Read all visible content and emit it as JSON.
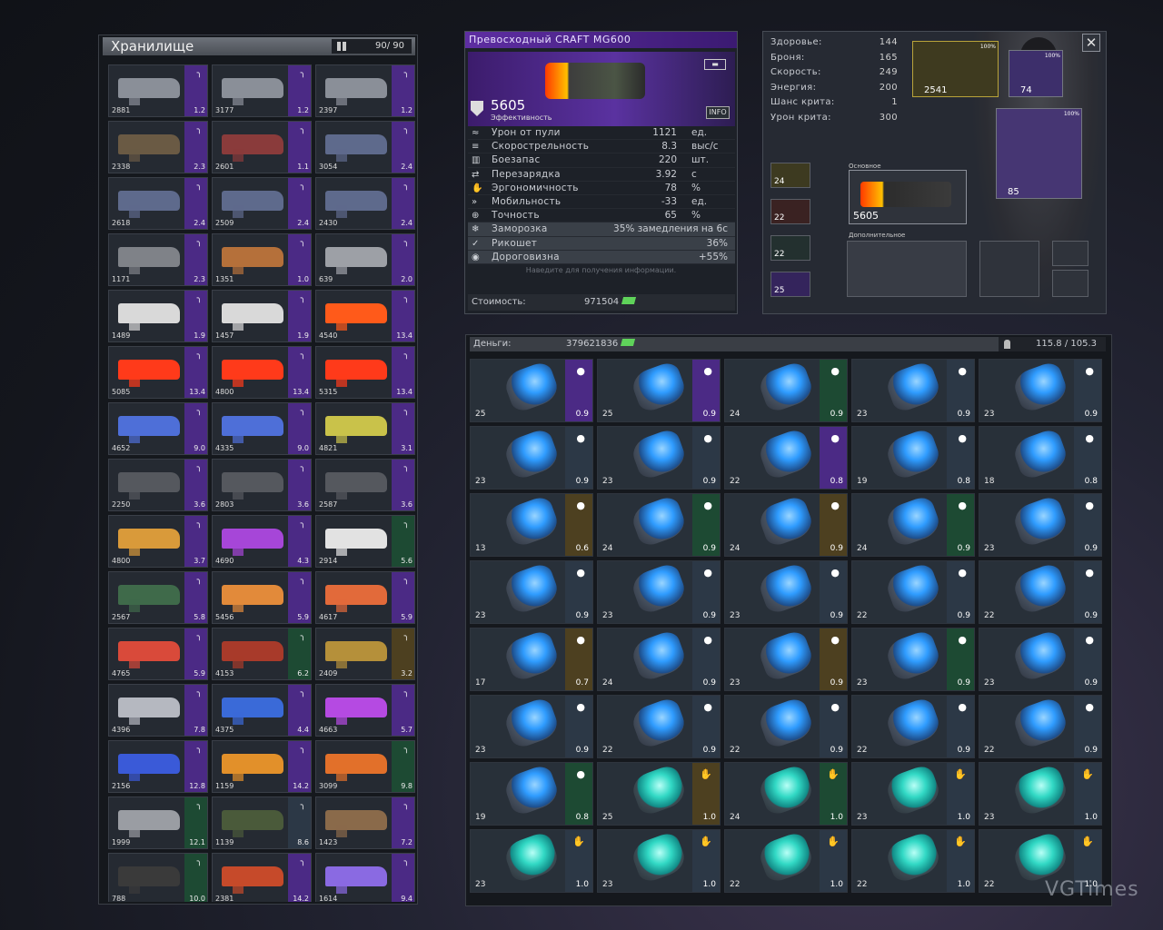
{
  "stash": {
    "title": "Хранилище",
    "capacity": "90/ 90",
    "items": [
      {
        "score": "2881",
        "weight": "1.2",
        "rarity": "violet",
        "color": "#8a8f98"
      },
      {
        "score": "3177",
        "weight": "1.2",
        "rarity": "violet",
        "color": "#8a8f98"
      },
      {
        "score": "2397",
        "weight": "1.2",
        "rarity": "violet",
        "color": "#8a8f98"
      },
      {
        "score": "2338",
        "weight": "2.3",
        "rarity": "violet",
        "color": "#6a5a44"
      },
      {
        "score": "2601",
        "weight": "1.1",
        "rarity": "violet",
        "color": "#8a3b3b"
      },
      {
        "score": "3054",
        "weight": "2.4",
        "rarity": "violet",
        "color": "#5e6a8c"
      },
      {
        "score": "2618",
        "weight": "2.4",
        "rarity": "violet",
        "color": "#5e6a8c"
      },
      {
        "score": "2509",
        "weight": "2.4",
        "rarity": "violet",
        "color": "#5e6a8c"
      },
      {
        "score": "2430",
        "weight": "2.4",
        "rarity": "violet",
        "color": "#5e6a8c"
      },
      {
        "score": "1171",
        "weight": "2.3",
        "rarity": "violet",
        "color": "#7f8288"
      },
      {
        "score": "1351",
        "weight": "1.0",
        "rarity": "violet",
        "color": "#b5703a"
      },
      {
        "score": "639",
        "weight": "2.0",
        "rarity": "violet",
        "color": "#9da0a6"
      },
      {
        "score": "1489",
        "weight": "1.9",
        "rarity": "violet",
        "color": "#d9d9d9"
      },
      {
        "score": "1457",
        "weight": "1.9",
        "rarity": "violet",
        "color": "#d9d9d9"
      },
      {
        "score": "4540",
        "weight": "13.4",
        "rarity": "violet",
        "color": "#ff5a1a"
      },
      {
        "score": "5085",
        "weight": "13.4",
        "rarity": "violet",
        "color": "#ff3a1a"
      },
      {
        "score": "4800",
        "weight": "13.4",
        "rarity": "violet",
        "color": "#ff3a1a"
      },
      {
        "score": "5315",
        "weight": "13.4",
        "rarity": "violet",
        "color": "#ff3a1a"
      },
      {
        "score": "4652",
        "weight": "9.0",
        "rarity": "violet",
        "color": "#4e6fd8"
      },
      {
        "score": "4335",
        "weight": "9.0",
        "rarity": "violet",
        "color": "#4e6fd8"
      },
      {
        "score": "4821",
        "weight": "3.1",
        "rarity": "violet",
        "color": "#c9c24a"
      },
      {
        "score": "2250",
        "weight": "3.6",
        "rarity": "violet",
        "color": "#55585e"
      },
      {
        "score": "2803",
        "weight": "3.6",
        "rarity": "violet",
        "color": "#55585e"
      },
      {
        "score": "2587",
        "weight": "3.6",
        "rarity": "violet",
        "color": "#55585e"
      },
      {
        "score": "4800",
        "weight": "3.7",
        "rarity": "violet",
        "color": "#d99a3a"
      },
      {
        "score": "4690",
        "weight": "4.3",
        "rarity": "violet",
        "color": "#a646d8"
      },
      {
        "score": "2914",
        "weight": "5.6",
        "rarity": "green",
        "color": "#e2e2e2"
      },
      {
        "score": "2567",
        "weight": "5.8",
        "rarity": "violet",
        "color": "#3f6a4a"
      },
      {
        "score": "5456",
        "weight": "5.9",
        "rarity": "violet",
        "color": "#e28a3a"
      },
      {
        "score": "4617",
        "weight": "5.9",
        "rarity": "violet",
        "color": "#e26a3a"
      },
      {
        "score": "4765",
        "weight": "5.9",
        "rarity": "violet",
        "color": "#d94a3a"
      },
      {
        "score": "4153",
        "weight": "6.2",
        "rarity": "green",
        "color": "#a83a2a"
      },
      {
        "score": "2409",
        "weight": "3.2",
        "rarity": "gold",
        "color": "#b5903a"
      },
      {
        "score": "4396",
        "weight": "7.8",
        "rarity": "violet",
        "color": "#b5b8c0"
      },
      {
        "score": "4375",
        "weight": "4.4",
        "rarity": "violet",
        "color": "#3a6ad8"
      },
      {
        "score": "4663",
        "weight": "5.7",
        "rarity": "violet",
        "color": "#b54ae2"
      },
      {
        "score": "2156",
        "weight": "12.8",
        "rarity": "violet",
        "color": "#3a5ad8"
      },
      {
        "score": "1159",
        "weight": "14.2",
        "rarity": "violet",
        "color": "#e2902a"
      },
      {
        "score": "3099",
        "weight": "9.8",
        "rarity": "green",
        "color": "#e2702a"
      },
      {
        "score": "1999",
        "weight": "12.1",
        "rarity": "green",
        "color": "#9a9da3"
      },
      {
        "score": "1139",
        "weight": "8.6",
        "rarity": "grey",
        "color": "#4a5a3a"
      },
      {
        "score": "1423",
        "weight": "7.2",
        "rarity": "violet",
        "color": "#8a6a4a"
      },
      {
        "score": "788",
        "weight": "10.0",
        "rarity": "green",
        "color": "#3a3a3a"
      },
      {
        "score": "2381",
        "weight": "14.2",
        "rarity": "violet",
        "color": "#c64a2a"
      },
      {
        "score": "1614",
        "weight": "9.4",
        "rarity": "violet",
        "color": "#8a6ae2"
      }
    ]
  },
  "detail": {
    "title": "Превосходный  CRAFT  MG600",
    "efficiency_value": "5605",
    "efficiency_label": "Эффективность",
    "info_label": "INFO",
    "stats": [
      {
        "icon": "≈",
        "name": "Урон  от  пули",
        "value": "1121",
        "unit": "ед."
      },
      {
        "icon": "≡",
        "name": "Скорострельность",
        "value": "8.3",
        "unit": "выс/с"
      },
      {
        "icon": "▥",
        "name": "Боезапас",
        "value": "220",
        "unit": "шт."
      },
      {
        "icon": "⇄",
        "name": "Перезарядка",
        "value": "3.92",
        "unit": "с"
      },
      {
        "icon": "✋",
        "name": "Эргономичность",
        "value": "78",
        "unit": "%"
      },
      {
        "icon": "»",
        "name": "Мобильность",
        "value": "-33",
        "unit": "ед."
      },
      {
        "icon": "⊕",
        "name": "Точность",
        "value": "65",
        "unit": "%"
      }
    ],
    "perks": [
      {
        "icon": "❄",
        "name": "Заморозка",
        "value": "35%  замедления  на  6с"
      },
      {
        "icon": "✓",
        "name": "Рикошет",
        "value": "36%"
      },
      {
        "icon": "◉",
        "name": "Дороговизна",
        "value": "+55%"
      }
    ],
    "hint": "Наведите  для  получения  информации.",
    "cost_label": "Стоимость:",
    "cost_value": "971504"
  },
  "character": {
    "stats": [
      {
        "name": "Здоровье:",
        "value": "144"
      },
      {
        "name": "Броня:",
        "value": "165"
      },
      {
        "name": "Скорость:",
        "value": "249"
      },
      {
        "name": "Энергия:",
        "value": "200"
      },
      {
        "name": "Шанс  крита:",
        "value": "1"
      },
      {
        "name": "Урон  крита:",
        "value": "300"
      }
    ],
    "slot_gun2": "2541",
    "slot_helmet": "74",
    "slot_helmet_pct": "100%",
    "slot_armor": "85",
    "slot_armor_pct": "100%",
    "slot_gun2_pct": "100%",
    "main_label": "Основное",
    "main_value": "5605",
    "extra_label": "Дополнительное",
    "mods": [
      "24",
      "22",
      "22",
      "25"
    ]
  },
  "inventory": {
    "money_label": "Деньги:",
    "money_value": "379621836",
    "load": "115.8 / 105.3",
    "items": [
      {
        "score": "25",
        "weight": "0.9",
        "rarity": "violet",
        "kind": "b",
        "icon": "●"
      },
      {
        "score": "25",
        "weight": "0.9",
        "rarity": "violet",
        "kind": "b",
        "icon": "●"
      },
      {
        "score": "24",
        "weight": "0.9",
        "rarity": "green",
        "kind": "b",
        "icon": "●"
      },
      {
        "score": "23",
        "weight": "0.9",
        "rarity": "grey",
        "kind": "b",
        "icon": "●"
      },
      {
        "score": "23",
        "weight": "0.9",
        "rarity": "grey",
        "kind": "b",
        "icon": "●"
      },
      {
        "score": "23",
        "weight": "0.9",
        "rarity": "grey",
        "kind": "b",
        "icon": "●"
      },
      {
        "score": "23",
        "weight": "0.9",
        "rarity": "grey",
        "kind": "b",
        "icon": "●"
      },
      {
        "score": "22",
        "weight": "0.8",
        "rarity": "violet",
        "kind": "b",
        "icon": "●"
      },
      {
        "score": "19",
        "weight": "0.8",
        "rarity": "grey",
        "kind": "b",
        "icon": "●"
      },
      {
        "score": "18",
        "weight": "0.8",
        "rarity": "grey",
        "kind": "b",
        "icon": "●"
      },
      {
        "score": "13",
        "weight": "0.6",
        "rarity": "gold",
        "kind": "b",
        "icon": "●"
      },
      {
        "score": "24",
        "weight": "0.9",
        "rarity": "green",
        "kind": "b",
        "icon": "●"
      },
      {
        "score": "24",
        "weight": "0.9",
        "rarity": "gold",
        "kind": "b",
        "icon": "●"
      },
      {
        "score": "24",
        "weight": "0.9",
        "rarity": "green",
        "kind": "b",
        "icon": "●"
      },
      {
        "score": "23",
        "weight": "0.9",
        "rarity": "grey",
        "kind": "b",
        "icon": "●"
      },
      {
        "score": "23",
        "weight": "0.9",
        "rarity": "grey",
        "kind": "b",
        "icon": "●"
      },
      {
        "score": "23",
        "weight": "0.9",
        "rarity": "grey",
        "kind": "b",
        "icon": "●"
      },
      {
        "score": "23",
        "weight": "0.9",
        "rarity": "grey",
        "kind": "b",
        "icon": "●"
      },
      {
        "score": "22",
        "weight": "0.9",
        "rarity": "grey",
        "kind": "b",
        "icon": "●"
      },
      {
        "score": "22",
        "weight": "0.9",
        "rarity": "grey",
        "kind": "b",
        "icon": "●"
      },
      {
        "score": "17",
        "weight": "0.7",
        "rarity": "gold",
        "kind": "b",
        "icon": "●"
      },
      {
        "score": "24",
        "weight": "0.9",
        "rarity": "grey",
        "kind": "b",
        "icon": "●"
      },
      {
        "score": "23",
        "weight": "0.9",
        "rarity": "gold",
        "kind": "b",
        "icon": "●"
      },
      {
        "score": "23",
        "weight": "0.9",
        "rarity": "green",
        "kind": "b",
        "icon": "●"
      },
      {
        "score": "23",
        "weight": "0.9",
        "rarity": "grey",
        "kind": "b",
        "icon": "●"
      },
      {
        "score": "23",
        "weight": "0.9",
        "rarity": "grey",
        "kind": "b",
        "icon": "●"
      },
      {
        "score": "22",
        "weight": "0.9",
        "rarity": "grey",
        "kind": "b",
        "icon": "●"
      },
      {
        "score": "22",
        "weight": "0.9",
        "rarity": "grey",
        "kind": "b",
        "icon": "●"
      },
      {
        "score": "22",
        "weight": "0.9",
        "rarity": "grey",
        "kind": "b",
        "icon": "●"
      },
      {
        "score": "22",
        "weight": "0.9",
        "rarity": "grey",
        "kind": "b",
        "icon": "●"
      },
      {
        "score": "19",
        "weight": "0.8",
        "rarity": "green",
        "kind": "b",
        "icon": "●"
      },
      {
        "score": "25",
        "weight": "1.0",
        "rarity": "gold",
        "kind": "t",
        "icon": "✋"
      },
      {
        "score": "24",
        "weight": "1.0",
        "rarity": "green",
        "kind": "t",
        "icon": "✋"
      },
      {
        "score": "23",
        "weight": "1.0",
        "rarity": "grey",
        "kind": "t",
        "icon": "✋"
      },
      {
        "score": "23",
        "weight": "1.0",
        "rarity": "grey",
        "kind": "t",
        "icon": "✋"
      },
      {
        "score": "23",
        "weight": "1.0",
        "rarity": "grey",
        "kind": "t",
        "icon": "✋"
      },
      {
        "score": "23",
        "weight": "1.0",
        "rarity": "grey",
        "kind": "t",
        "icon": "✋"
      },
      {
        "score": "22",
        "weight": "1.0",
        "rarity": "grey",
        "kind": "t",
        "icon": "✋"
      },
      {
        "score": "22",
        "weight": "1.0",
        "rarity": "grey",
        "kind": "t",
        "icon": "✋"
      },
      {
        "score": "22",
        "weight": "1.0",
        "rarity": "grey",
        "kind": "t",
        "icon": "✋"
      }
    ]
  },
  "watermark": "VGTimes"
}
